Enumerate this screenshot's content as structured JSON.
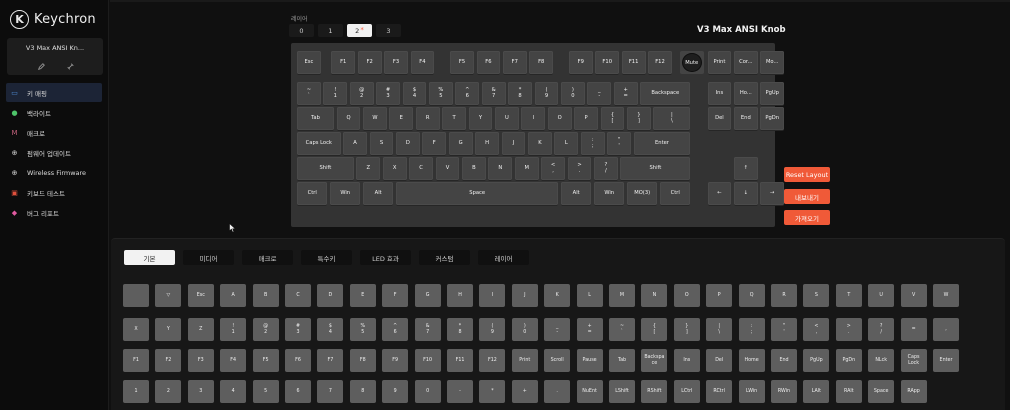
{
  "app": {
    "brand": "Keychron",
    "logo_letter": "K"
  },
  "device": {
    "name": "V3 Max ANSI Kn...",
    "left_icon": "pencil-icon",
    "right_icon": "link-icon"
  },
  "nav": [
    {
      "label": "키 매핑",
      "icon": "keyboard-icon",
      "color": "#4f8dd8",
      "glyph": "▭"
    },
    {
      "label": "백라이트",
      "icon": "bulb-icon",
      "color": "#4ec46a",
      "glyph": "●"
    },
    {
      "label": "매크로",
      "icon": "macro-icon",
      "color": "#c0607a",
      "glyph": "M"
    },
    {
      "label": "펌웨어 업데이트",
      "icon": "firmware-icon",
      "color": "#d8d8d8",
      "glyph": "⊕"
    },
    {
      "label": "Wireless Firmware",
      "icon": "wireless-icon",
      "color": "#d8d8d8",
      "glyph": "⊕"
    },
    {
      "label": "키보드 테스트",
      "icon": "test-icon",
      "color": "#e0503c",
      "glyph": "▣"
    },
    {
      "label": "버그 리포트",
      "icon": "bug-icon",
      "color": "#e05aa0",
      "glyph": "◆"
    }
  ],
  "layer": {
    "label": "레이어",
    "tabs": [
      "0",
      "1",
      "2",
      "3"
    ],
    "active": 2,
    "dot_tab": 2,
    "dot": "*"
  },
  "keyboard_title": "V3 Max ANSI Knob",
  "keys": {
    "rows": [
      [
        {
          "t": "Esc"
        },
        {
          "t": "F1"
        },
        {
          "t": "F2"
        },
        {
          "t": "F3"
        },
        {
          "t": "F4"
        },
        {
          "t": "F5"
        },
        {
          "t": "F6"
        },
        {
          "t": "F7"
        },
        {
          "t": "F8"
        },
        {
          "t": "F9"
        },
        {
          "t": "F10"
        },
        {
          "t": "F11"
        },
        {
          "t": "F12"
        }
      ],
      [
        {
          "t": "~",
          "b": "`"
        },
        {
          "t": "!",
          "b": "1"
        },
        {
          "t": "@",
          "b": "2"
        },
        {
          "t": "#",
          "b": "3"
        },
        {
          "t": "$",
          "b": "4"
        },
        {
          "t": "%",
          "b": "5"
        },
        {
          "t": "^",
          "b": "6"
        },
        {
          "t": "&",
          "b": "7"
        },
        {
          "t": "*",
          "b": "8"
        },
        {
          "t": "(",
          "b": "9"
        },
        {
          "t": ")",
          "b": "0"
        },
        {
          "t": "_",
          "b": "-"
        },
        {
          "t": "+",
          "b": "="
        },
        {
          "t": "Backspace"
        }
      ],
      [
        {
          "t": "Tab"
        },
        {
          "t": "Q"
        },
        {
          "t": "W"
        },
        {
          "t": "E"
        },
        {
          "t": "R"
        },
        {
          "t": "T"
        },
        {
          "t": "Y"
        },
        {
          "t": "U"
        },
        {
          "t": "I"
        },
        {
          "t": "O"
        },
        {
          "t": "P"
        },
        {
          "t": "{",
          "b": "["
        },
        {
          "t": "}",
          "b": "]"
        },
        {
          "t": "|",
          "b": "\\"
        }
      ],
      [
        {
          "t": "Caps Lock"
        },
        {
          "t": "A"
        },
        {
          "t": "S"
        },
        {
          "t": "D"
        },
        {
          "t": "F"
        },
        {
          "t": "G"
        },
        {
          "t": "H"
        },
        {
          "t": "J"
        },
        {
          "t": "K"
        },
        {
          "t": "L"
        },
        {
          "t": ":",
          "b": ";"
        },
        {
          "t": "\"",
          "b": "'"
        },
        {
          "t": "Enter"
        }
      ],
      [
        {
          "t": "Shift"
        },
        {
          "t": "Z"
        },
        {
          "t": "X"
        },
        {
          "t": "C"
        },
        {
          "t": "V"
        },
        {
          "t": "B"
        },
        {
          "t": "N"
        },
        {
          "t": "M"
        },
        {
          "t": "<",
          "b": ","
        },
        {
          "t": ">",
          "b": "."
        },
        {
          "t": "?",
          "b": "/"
        },
        {
          "t": "Shift"
        }
      ],
      [
        {
          "t": "Ctrl"
        },
        {
          "t": "Win"
        },
        {
          "t": "Alt"
        },
        {
          "t": "Space"
        },
        {
          "t": "Alt"
        },
        {
          "t": "Win"
        },
        {
          "t": "MO(3)"
        },
        {
          "t": "Ctrl"
        }
      ]
    ],
    "knob": "Mute",
    "nav_cluster": [
      {
        "t": "Print"
      },
      {
        "t": "Cor..."
      },
      {
        "t": "Mo..."
      },
      {
        "t": "Ins"
      },
      {
        "t": "Ho..."
      },
      {
        "t": "PgUp"
      },
      {
        "t": "Del"
      },
      {
        "t": "End"
      },
      {
        "t": "PgDn"
      }
    ],
    "arrows": [
      {
        "t": "↑"
      },
      {
        "t": "←"
      },
      {
        "t": "↓"
      },
      {
        "t": "→"
      }
    ]
  },
  "actions": {
    "reset": "Reset Layout",
    "export": "내보내기",
    "import": "가져오기"
  },
  "category_tabs": [
    "기본",
    "미디어",
    "매크로",
    "특수키",
    "LED 효과",
    "커스텀",
    "레이어"
  ],
  "category_active": 0,
  "palette": [
    [
      {
        "t": ""
      },
      {
        "t": "▽"
      },
      {
        "t": "Esc"
      },
      {
        "t": "A"
      },
      {
        "t": "B"
      },
      {
        "t": "C"
      },
      {
        "t": "D"
      },
      {
        "t": "E"
      },
      {
        "t": "F"
      },
      {
        "t": "G"
      },
      {
        "t": "H"
      },
      {
        "t": "I"
      },
      {
        "t": "J"
      },
      {
        "t": "K"
      },
      {
        "t": "L"
      },
      {
        "t": "M"
      },
      {
        "t": "N"
      },
      {
        "t": "O"
      },
      {
        "t": "P"
      },
      {
        "t": "Q"
      },
      {
        "t": "R"
      },
      {
        "t": "S"
      },
      {
        "t": "T"
      },
      {
        "t": "U"
      },
      {
        "t": "V"
      },
      {
        "t": "W"
      }
    ],
    [
      {
        "t": "X"
      },
      {
        "t": "Y"
      },
      {
        "t": "Z"
      },
      {
        "t": "!",
        "b": "1"
      },
      {
        "t": "@",
        "b": "2"
      },
      {
        "t": "#",
        "b": "3"
      },
      {
        "t": "$",
        "b": "4"
      },
      {
        "t": "%",
        "b": "5"
      },
      {
        "t": "^",
        "b": "6"
      },
      {
        "t": "&",
        "b": "7"
      },
      {
        "t": "*",
        "b": "8"
      },
      {
        "t": "(",
        "b": "9"
      },
      {
        "t": ")",
        "b": "0"
      },
      {
        "t": "_",
        "b": "-"
      },
      {
        "t": "+",
        "b": "="
      },
      {
        "t": "~",
        "b": "`"
      },
      {
        "t": "{",
        "b": "["
      },
      {
        "t": "}",
        "b": "]"
      },
      {
        "t": "|",
        "b": "\\"
      },
      {
        "t": ":",
        "b": ";"
      },
      {
        "t": "\"",
        "b": "'"
      },
      {
        "t": "<",
        "b": ","
      },
      {
        "t": ">",
        "b": "."
      },
      {
        "t": "?",
        "b": "/"
      },
      {
        "t": "="
      },
      {
        "t": ","
      }
    ],
    [
      {
        "t": "F1"
      },
      {
        "t": "F2"
      },
      {
        "t": "F3"
      },
      {
        "t": "F4"
      },
      {
        "t": "F5"
      },
      {
        "t": "F6"
      },
      {
        "t": "F7"
      },
      {
        "t": "F8"
      },
      {
        "t": "F9"
      },
      {
        "t": "F10"
      },
      {
        "t": "F11"
      },
      {
        "t": "F12"
      },
      {
        "t": "Print"
      },
      {
        "t": "Scroll"
      },
      {
        "t": "Pause"
      },
      {
        "t": "Tab"
      },
      {
        "t": "Backspa",
        "b": "ce"
      },
      {
        "t": "Ins"
      },
      {
        "t": "Del"
      },
      {
        "t": "Home"
      },
      {
        "t": "End"
      },
      {
        "t": "PgUp"
      },
      {
        "t": "PgDn"
      },
      {
        "t": "NLck"
      },
      {
        "t": "Caps",
        "b": "Lock"
      },
      {
        "t": "Enter"
      }
    ],
    [
      {
        "t": "1"
      },
      {
        "t": "2"
      },
      {
        "t": "3"
      },
      {
        "t": "4"
      },
      {
        "t": "5"
      },
      {
        "t": "6"
      },
      {
        "t": "7"
      },
      {
        "t": "8"
      },
      {
        "t": "9"
      },
      {
        "t": "0"
      },
      {
        "t": "-"
      },
      {
        "t": "*"
      },
      {
        "t": "+"
      },
      {
        "t": "."
      },
      {
        "t": "NuEnt"
      },
      {
        "t": "LShift"
      },
      {
        "t": "RShift"
      },
      {
        "t": "LCtrl"
      },
      {
        "t": "RCtrl"
      },
      {
        "t": "LWin"
      },
      {
        "t": "RWin"
      },
      {
        "t": "LAlt"
      },
      {
        "t": "RAlt"
      },
      {
        "t": "Space"
      },
      {
        "t": "RApp"
      }
    ]
  ],
  "colors": {
    "accent": "#f05a38",
    "key": "#444444",
    "board": "#333333",
    "palette_key": "#5e5e5e"
  }
}
